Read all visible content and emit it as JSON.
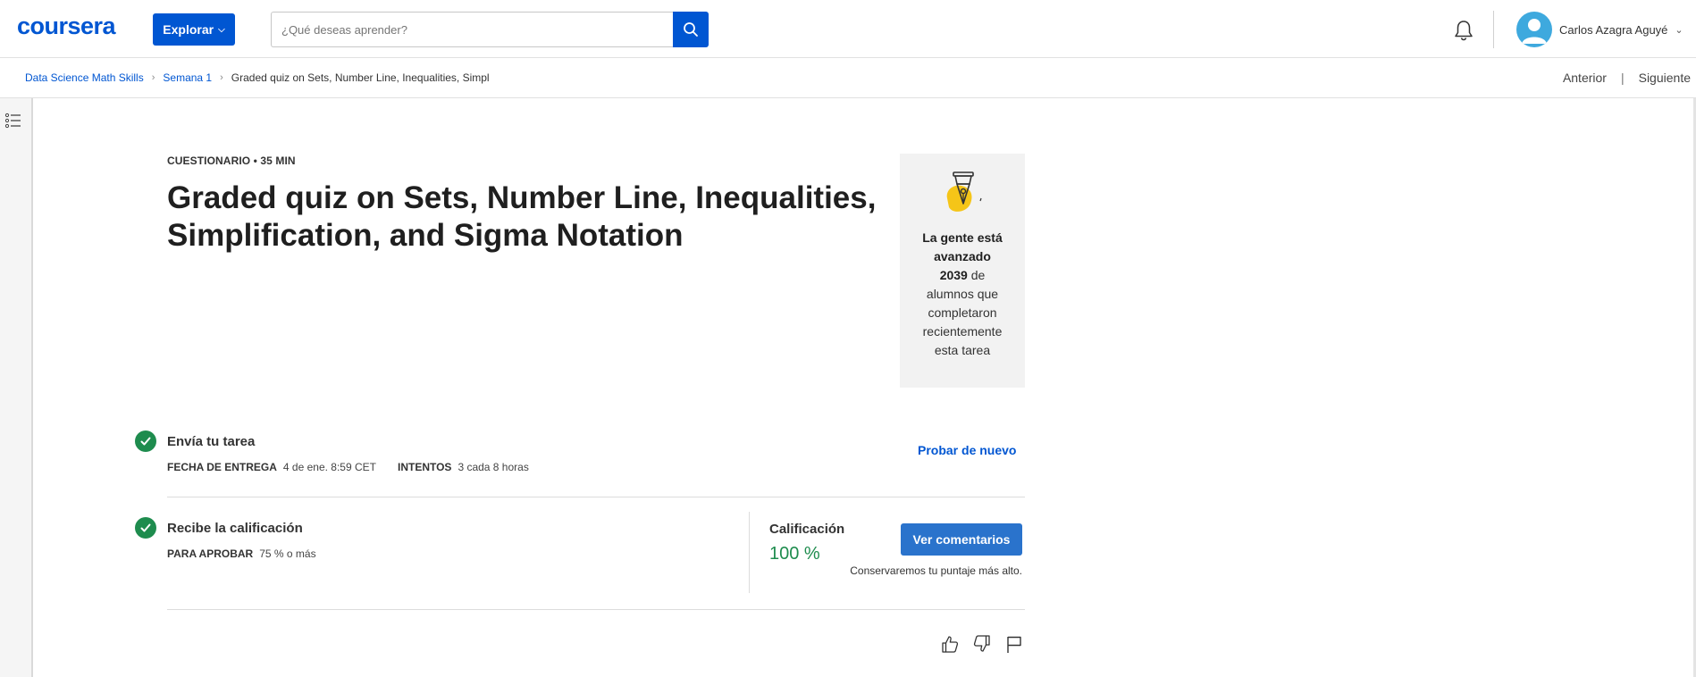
{
  "header": {
    "logo": "coursera",
    "explore_label": "Explorar",
    "search_placeholder": "¿Qué deseas aprender?",
    "user_name": "Carlos Azagra Aguyé"
  },
  "breadcrumb": {
    "items": [
      "Data Science Math Skills",
      "Semana 1"
    ],
    "current": "Graded quiz on Sets, Number Line, Inequalities, Simpl"
  },
  "pager": {
    "prev": "Anterior",
    "separator": "|",
    "next": "Siguiente"
  },
  "assignment": {
    "eyebrow": "CUESTIONARIO • 35 MIN",
    "title": "Graded quiz on Sets, Number Line, Inequalities, Simplification, and Sigma Notation"
  },
  "social": {
    "headline_line1": "La gente está",
    "headline_line2": "avanzado",
    "count": "2039",
    "count_suffix": " de",
    "line3": "alumnos que",
    "line4": "completaron",
    "line5": "recientemente",
    "line6": "esta tarea"
  },
  "submit_row": {
    "title": "Envía tu tarea",
    "due_label": "FECHA DE ENTREGA",
    "due_value": "4 de ene. 8:59 CET",
    "attempts_label": "INTENTOS",
    "attempts_value": "3 cada 8 horas",
    "retry_label": "Probar de nuevo"
  },
  "grade_row": {
    "title": "Recibe la calificación",
    "pass_label": "PARA APROBAR",
    "pass_value": "75 % o más",
    "grade_label": "Calificación",
    "grade_value": "100 %",
    "feedback_button": "Ver comentarios",
    "keep_note": "Conservaremos tu puntaje más alto."
  },
  "icons": {
    "bell": "bell-icon",
    "search": "search-icon",
    "list": "list-icon",
    "like": "thumbs-up-icon",
    "dislike": "thumbs-down-icon",
    "flag": "flag-icon"
  },
  "colors": {
    "brand": "#0056d2",
    "success": "#1e8c4e",
    "button": "#2a73cc"
  }
}
